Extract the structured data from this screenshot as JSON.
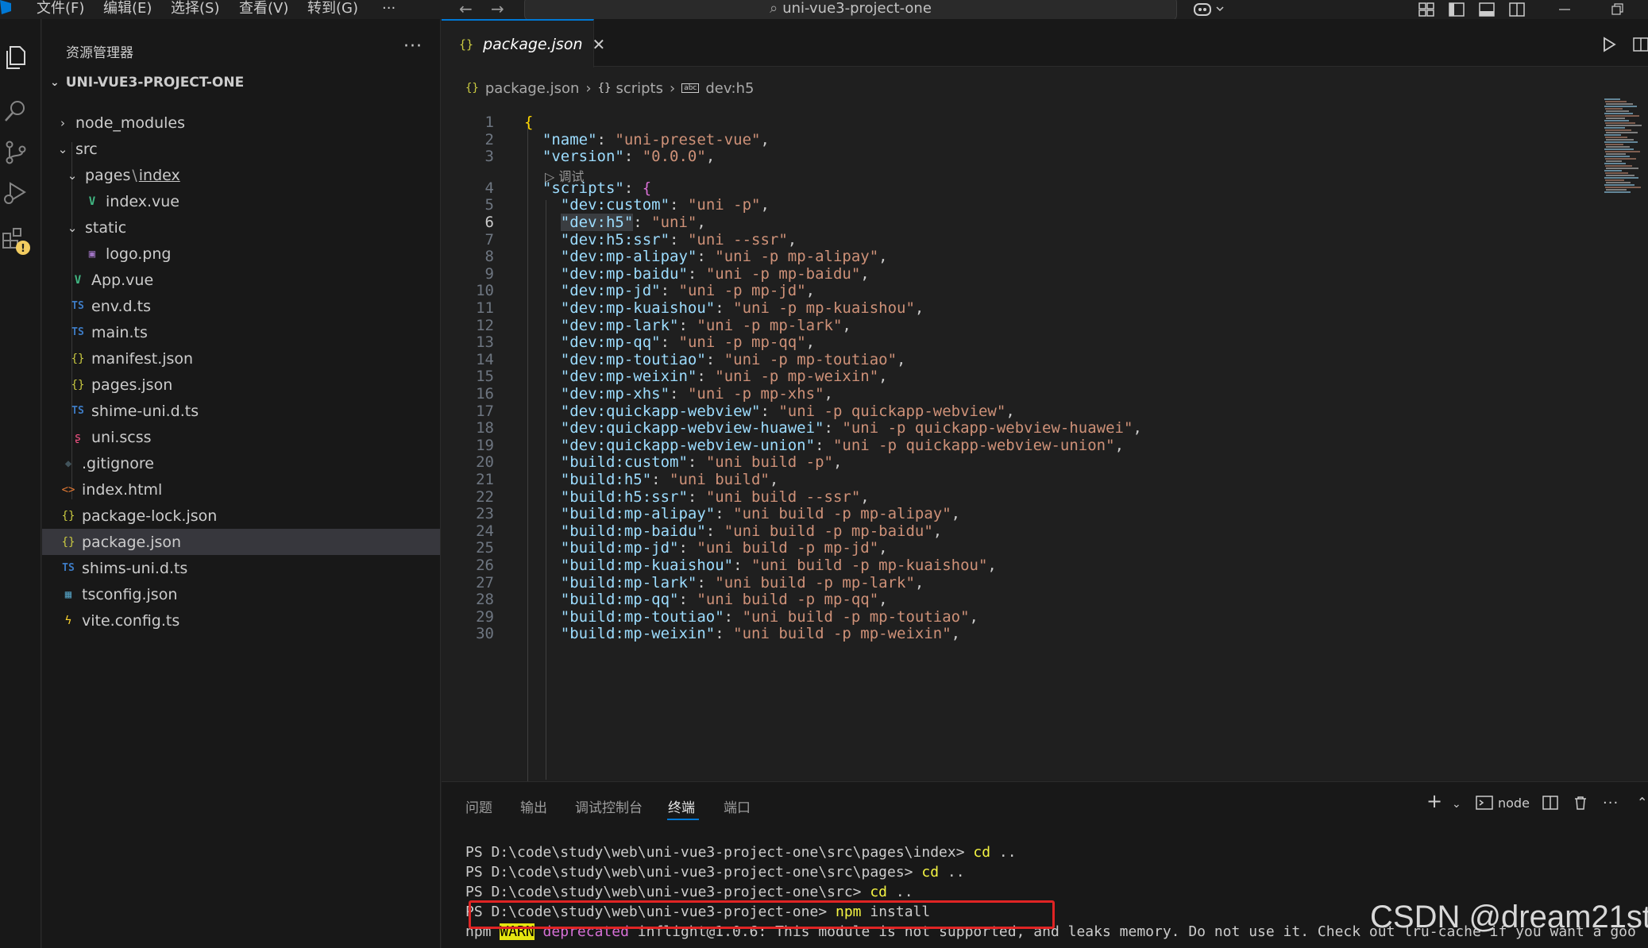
{
  "titlebar": {
    "menus": [
      "文件(F)",
      "编辑(E)",
      "选择(S)",
      "查看(V)",
      "转到(G)",
      "···"
    ],
    "search_text": "uni-vue3-project-one"
  },
  "sidebar": {
    "title": "资源管理器",
    "more": "···",
    "project": "UNI-VUE3-PROJECT-ONE",
    "items": [
      {
        "label": "node_modules",
        "kind": "folder",
        "open": false
      },
      {
        "label": "src",
        "kind": "folder",
        "open": true
      },
      {
        "label": "pages",
        "label2": "index",
        "kind": "folder",
        "open": true
      },
      {
        "label": "index.vue",
        "kind": "vue"
      },
      {
        "label": "static",
        "kind": "folder",
        "open": true
      },
      {
        "label": "logo.png",
        "kind": "png"
      },
      {
        "label": "App.vue",
        "kind": "vue"
      },
      {
        "label": "env.d.ts",
        "kind": "ts"
      },
      {
        "label": "main.ts",
        "kind": "ts"
      },
      {
        "label": "manifest.json",
        "kind": "json"
      },
      {
        "label": "pages.json",
        "kind": "json"
      },
      {
        "label": "shime-uni.d.ts",
        "kind": "ts"
      },
      {
        "label": "uni.scss",
        "kind": "scss"
      },
      {
        "label": ".gitignore",
        "kind": "git"
      },
      {
        "label": "index.html",
        "kind": "html"
      },
      {
        "label": "package-lock.json",
        "kind": "json"
      },
      {
        "label": "package.json",
        "kind": "json"
      },
      {
        "label": "shims-uni.d.ts",
        "kind": "ts"
      },
      {
        "label": "tsconfig.json",
        "kind": "cfg"
      },
      {
        "label": "vite.config.ts",
        "kind": "vite"
      }
    ]
  },
  "editor": {
    "tab_label": "package.json",
    "breadcrumb": [
      "package.json",
      "scripts",
      "dev:h5"
    ],
    "codelens": "调试",
    "lines": [
      {
        "n": "1",
        "key": "",
        "val": "",
        "open": "{"
      },
      {
        "n": "2",
        "key": "\"name\"",
        "val": "\"uni-preset-vue\""
      },
      {
        "n": "3",
        "key": "\"version\"",
        "val": "\"0.0.0\""
      },
      {
        "n": "4",
        "key": "\"scripts\"",
        "val": "",
        "open": "{"
      },
      {
        "n": "5",
        "key": "\"dev:custom\"",
        "val": "\"uni -p\""
      },
      {
        "n": "6",
        "key": "\"dev:h5\"",
        "val": "\"uni\""
      },
      {
        "n": "7",
        "key": "\"dev:h5:ssr\"",
        "val": "\"uni --ssr\""
      },
      {
        "n": "8",
        "key": "\"dev:mp-alipay\"",
        "val": "\"uni -p mp-alipay\""
      },
      {
        "n": "9",
        "key": "\"dev:mp-baidu\"",
        "val": "\"uni -p mp-baidu\""
      },
      {
        "n": "10",
        "key": "\"dev:mp-jd\"",
        "val": "\"uni -p mp-jd\""
      },
      {
        "n": "11",
        "key": "\"dev:mp-kuaishou\"",
        "val": "\"uni -p mp-kuaishou\""
      },
      {
        "n": "12",
        "key": "\"dev:mp-lark\"",
        "val": "\"uni -p mp-lark\""
      },
      {
        "n": "13",
        "key": "\"dev:mp-qq\"",
        "val": "\"uni -p mp-qq\""
      },
      {
        "n": "14",
        "key": "\"dev:mp-toutiao\"",
        "val": "\"uni -p mp-toutiao\""
      },
      {
        "n": "15",
        "key": "\"dev:mp-weixin\"",
        "val": "\"uni -p mp-weixin\""
      },
      {
        "n": "16",
        "key": "\"dev:mp-xhs\"",
        "val": "\"uni -p mp-xhs\""
      },
      {
        "n": "17",
        "key": "\"dev:quickapp-webview\"",
        "val": "\"uni -p quickapp-webview\""
      },
      {
        "n": "18",
        "key": "\"dev:quickapp-webview-huawei\"",
        "val": "\"uni -p quickapp-webview-huawei\""
      },
      {
        "n": "19",
        "key": "\"dev:quickapp-webview-union\"",
        "val": "\"uni -p quickapp-webview-union\""
      },
      {
        "n": "20",
        "key": "\"build:custom\"",
        "val": "\"uni build -p\""
      },
      {
        "n": "21",
        "key": "\"build:h5\"",
        "val": "\"uni build\""
      },
      {
        "n": "22",
        "key": "\"build:h5:ssr\"",
        "val": "\"uni build --ssr\""
      },
      {
        "n": "23",
        "key": "\"build:mp-alipay\"",
        "val": "\"uni build -p mp-alipay\""
      },
      {
        "n": "24",
        "key": "\"build:mp-baidu\"",
        "val": "\"uni build -p mp-baidu\""
      },
      {
        "n": "25",
        "key": "\"build:mp-jd\"",
        "val": "\"uni build -p mp-jd\""
      },
      {
        "n": "26",
        "key": "\"build:mp-kuaishou\"",
        "val": "\"uni build -p mp-kuaishou\""
      },
      {
        "n": "27",
        "key": "\"build:mp-lark\"",
        "val": "\"uni build -p mp-lark\""
      },
      {
        "n": "28",
        "key": "\"build:mp-qq\"",
        "val": "\"uni build -p mp-qq\""
      },
      {
        "n": "29",
        "key": "\"build:mp-toutiao\"",
        "val": "\"uni build -p mp-toutiao\""
      },
      {
        "n": "30",
        "key": "\"build:mp-weixin\"",
        "val": "\"uni build -p mp-weixin\""
      }
    ]
  },
  "panel": {
    "tabs": [
      "问题",
      "输出",
      "调试控制台",
      "终端",
      "端口"
    ],
    "terminal_name": "node",
    "terminal": [
      {
        "prompt": "PS D:\\code\\study\\web\\uni-vue3-project-one\\src\\pages\\index> ",
        "cmd": "cd",
        "rest": " .."
      },
      {
        "prompt": "PS D:\\code\\study\\web\\uni-vue3-project-one\\src\\pages> ",
        "cmd": "cd",
        "rest": " .."
      },
      {
        "prompt": "PS D:\\code\\study\\web\\uni-vue3-project-one\\src> ",
        "cmd": "cd",
        "rest": " .."
      },
      {
        "prompt": "PS D:\\code\\study\\web\\uni-vue3-project-one> ",
        "cmd": "npm",
        "rest": " install"
      }
    ],
    "warn_line": {
      "npm": "npm ",
      "warn": "WARN",
      "dep": " deprecated",
      "msg": " inflight@1.0.6: This module is not supported, and leaks memory. Do not use it. Check out lru-cache if you want a goo"
    }
  },
  "watermark": "CSDN @dream21st",
  "colors": {
    "accent": "#0078d4",
    "highlight_box": "#e02424",
    "warning_badge": "#f2cc60"
  }
}
